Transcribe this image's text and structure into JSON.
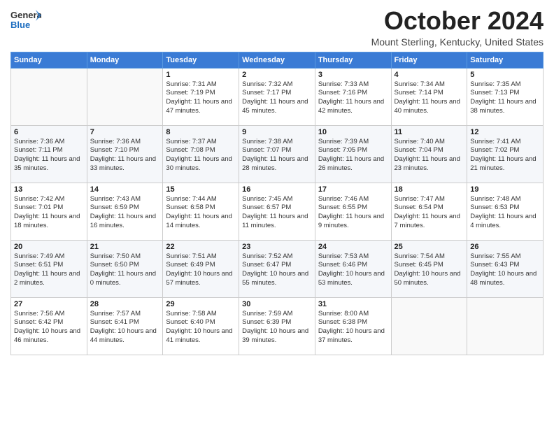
{
  "header": {
    "logo_general": "General",
    "logo_blue": "Blue",
    "month_title": "October 2024",
    "location": "Mount Sterling, Kentucky, United States"
  },
  "days_of_week": [
    "Sunday",
    "Monday",
    "Tuesday",
    "Wednesday",
    "Thursday",
    "Friday",
    "Saturday"
  ],
  "weeks": [
    [
      {
        "num": "",
        "info": ""
      },
      {
        "num": "",
        "info": ""
      },
      {
        "num": "1",
        "info": "Sunrise: 7:31 AM\nSunset: 7:19 PM\nDaylight: 11 hours and 47 minutes."
      },
      {
        "num": "2",
        "info": "Sunrise: 7:32 AM\nSunset: 7:17 PM\nDaylight: 11 hours and 45 minutes."
      },
      {
        "num": "3",
        "info": "Sunrise: 7:33 AM\nSunset: 7:16 PM\nDaylight: 11 hours and 42 minutes."
      },
      {
        "num": "4",
        "info": "Sunrise: 7:34 AM\nSunset: 7:14 PM\nDaylight: 11 hours and 40 minutes."
      },
      {
        "num": "5",
        "info": "Sunrise: 7:35 AM\nSunset: 7:13 PM\nDaylight: 11 hours and 38 minutes."
      }
    ],
    [
      {
        "num": "6",
        "info": "Sunrise: 7:36 AM\nSunset: 7:11 PM\nDaylight: 11 hours and 35 minutes."
      },
      {
        "num": "7",
        "info": "Sunrise: 7:36 AM\nSunset: 7:10 PM\nDaylight: 11 hours and 33 minutes."
      },
      {
        "num": "8",
        "info": "Sunrise: 7:37 AM\nSunset: 7:08 PM\nDaylight: 11 hours and 30 minutes."
      },
      {
        "num": "9",
        "info": "Sunrise: 7:38 AM\nSunset: 7:07 PM\nDaylight: 11 hours and 28 minutes."
      },
      {
        "num": "10",
        "info": "Sunrise: 7:39 AM\nSunset: 7:05 PM\nDaylight: 11 hours and 26 minutes."
      },
      {
        "num": "11",
        "info": "Sunrise: 7:40 AM\nSunset: 7:04 PM\nDaylight: 11 hours and 23 minutes."
      },
      {
        "num": "12",
        "info": "Sunrise: 7:41 AM\nSunset: 7:02 PM\nDaylight: 11 hours and 21 minutes."
      }
    ],
    [
      {
        "num": "13",
        "info": "Sunrise: 7:42 AM\nSunset: 7:01 PM\nDaylight: 11 hours and 18 minutes."
      },
      {
        "num": "14",
        "info": "Sunrise: 7:43 AM\nSunset: 6:59 PM\nDaylight: 11 hours and 16 minutes."
      },
      {
        "num": "15",
        "info": "Sunrise: 7:44 AM\nSunset: 6:58 PM\nDaylight: 11 hours and 14 minutes."
      },
      {
        "num": "16",
        "info": "Sunrise: 7:45 AM\nSunset: 6:57 PM\nDaylight: 11 hours and 11 minutes."
      },
      {
        "num": "17",
        "info": "Sunrise: 7:46 AM\nSunset: 6:55 PM\nDaylight: 11 hours and 9 minutes."
      },
      {
        "num": "18",
        "info": "Sunrise: 7:47 AM\nSunset: 6:54 PM\nDaylight: 11 hours and 7 minutes."
      },
      {
        "num": "19",
        "info": "Sunrise: 7:48 AM\nSunset: 6:53 PM\nDaylight: 11 hours and 4 minutes."
      }
    ],
    [
      {
        "num": "20",
        "info": "Sunrise: 7:49 AM\nSunset: 6:51 PM\nDaylight: 11 hours and 2 minutes."
      },
      {
        "num": "21",
        "info": "Sunrise: 7:50 AM\nSunset: 6:50 PM\nDaylight: 11 hours and 0 minutes."
      },
      {
        "num": "22",
        "info": "Sunrise: 7:51 AM\nSunset: 6:49 PM\nDaylight: 10 hours and 57 minutes."
      },
      {
        "num": "23",
        "info": "Sunrise: 7:52 AM\nSunset: 6:47 PM\nDaylight: 10 hours and 55 minutes."
      },
      {
        "num": "24",
        "info": "Sunrise: 7:53 AM\nSunset: 6:46 PM\nDaylight: 10 hours and 53 minutes."
      },
      {
        "num": "25",
        "info": "Sunrise: 7:54 AM\nSunset: 6:45 PM\nDaylight: 10 hours and 50 minutes."
      },
      {
        "num": "26",
        "info": "Sunrise: 7:55 AM\nSunset: 6:43 PM\nDaylight: 10 hours and 48 minutes."
      }
    ],
    [
      {
        "num": "27",
        "info": "Sunrise: 7:56 AM\nSunset: 6:42 PM\nDaylight: 10 hours and 46 minutes."
      },
      {
        "num": "28",
        "info": "Sunrise: 7:57 AM\nSunset: 6:41 PM\nDaylight: 10 hours and 44 minutes."
      },
      {
        "num": "29",
        "info": "Sunrise: 7:58 AM\nSunset: 6:40 PM\nDaylight: 10 hours and 41 minutes."
      },
      {
        "num": "30",
        "info": "Sunrise: 7:59 AM\nSunset: 6:39 PM\nDaylight: 10 hours and 39 minutes."
      },
      {
        "num": "31",
        "info": "Sunrise: 8:00 AM\nSunset: 6:38 PM\nDaylight: 10 hours and 37 minutes."
      },
      {
        "num": "",
        "info": ""
      },
      {
        "num": "",
        "info": ""
      }
    ]
  ]
}
